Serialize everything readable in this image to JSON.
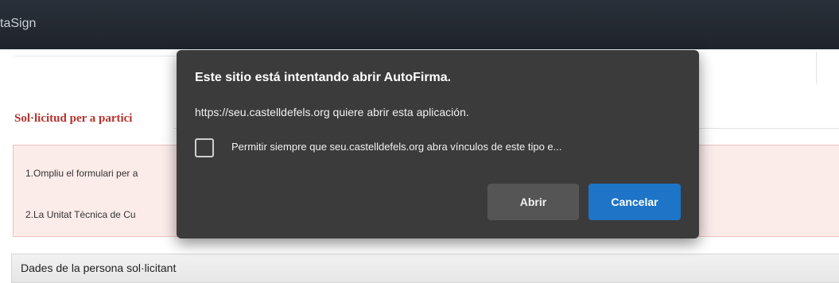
{
  "app": {
    "brand": "taSign"
  },
  "page": {
    "section_title": "Sol·licitud per a partici",
    "notice_line_1": "1.Ompliu el formulari per a",
    "notice_line_2": "2.La Unitat Tècnica de Cu",
    "panel_title": "Dades de la persona sol·licitant"
  },
  "dialog": {
    "title": "Este sitio está intentando abrir AutoFirma.",
    "message": "https://seu.castelldefels.org quiere abrir esta aplicación.",
    "checkbox_label": "Permitir siempre que seu.castelldefels.org abra vínculos de este tipo e...",
    "checkbox_checked": false,
    "open_label": "Abrir",
    "cancel_label": "Cancelar"
  },
  "colors": {
    "topbar": "#1f242b",
    "dialog_bg": "#3b3b3b",
    "primary_button": "#1e74c6",
    "section_title": "#b5322c",
    "notice_bg": "#fbecea"
  }
}
